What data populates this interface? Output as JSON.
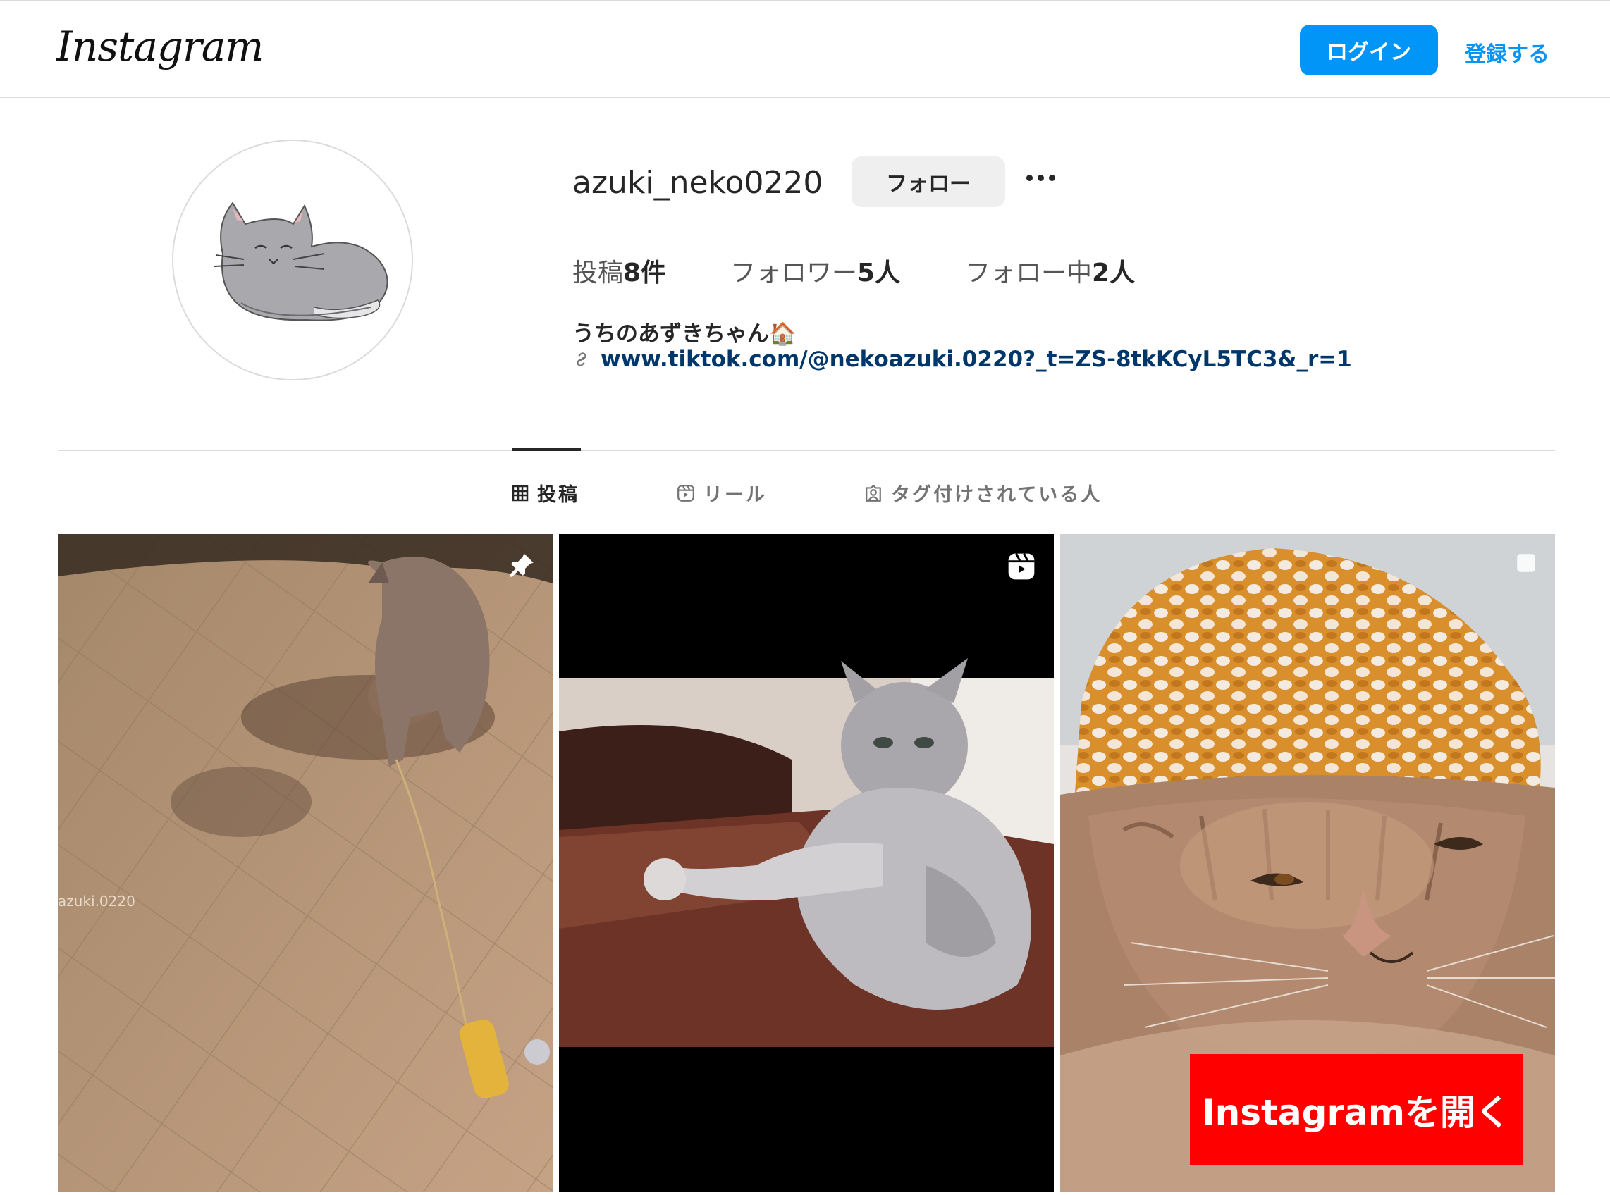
{
  "header": {
    "logo_text": "Instagram",
    "login_label": "ログイン",
    "signup_label": "登録する"
  },
  "profile": {
    "username": "azuki_neko0220",
    "follow_label": "フォロー",
    "stats": {
      "posts_label": "投稿",
      "posts_count": "8件",
      "followers_label": "フォロワー",
      "followers_count": "5人",
      "following_label": "フォロー中",
      "following_count": "2人"
    },
    "bio_name": "うちのあずきちゃん🏠",
    "link": "www.tiktok.com/@nekoazuki.0220?_t=ZS-8tkKCyL5TC3&_r=1"
  },
  "tabs": [
    {
      "label": "投稿",
      "icon": "grid-icon",
      "active": true
    },
    {
      "label": "リール",
      "icon": "reels-icon",
      "active": false
    },
    {
      "label": "タグ付けされている人",
      "icon": "tagged-icon",
      "active": false
    }
  ],
  "posts": [
    {
      "badge": "pin-icon",
      "watermark": "azuki.0220"
    },
    {
      "badge": "reels-icon"
    },
    {
      "badge": "multi-post-icon"
    }
  ],
  "overlay": {
    "open_app_label": "Instagramを開く"
  },
  "colors": {
    "accent": "#0095f6",
    "link": "#00376b",
    "cta_red": "#ff0000"
  }
}
